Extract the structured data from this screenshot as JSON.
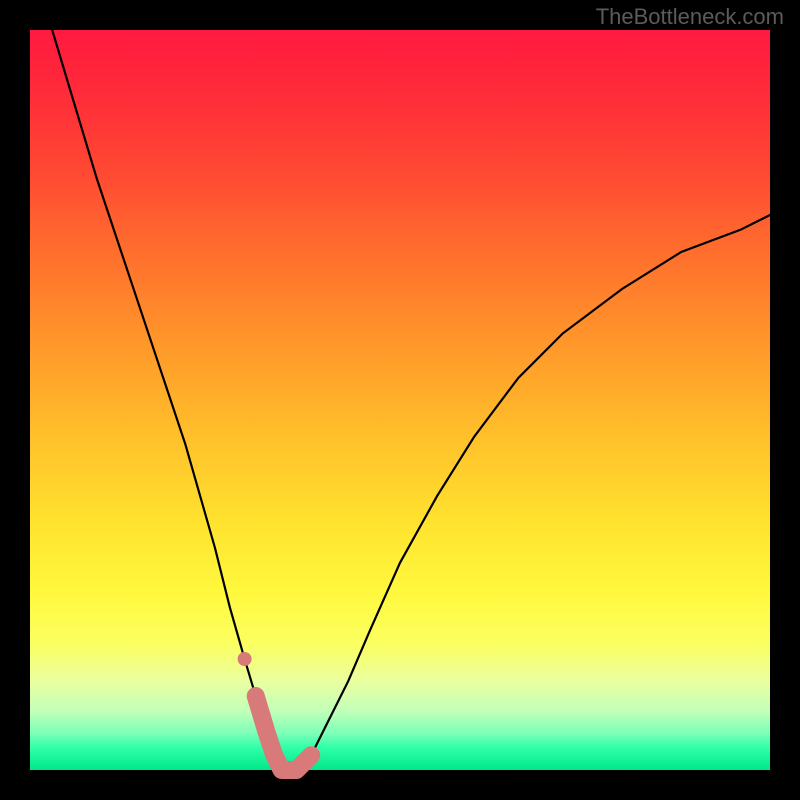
{
  "watermark": "TheBottleneck.com",
  "chart_data": {
    "type": "line",
    "title": "",
    "xlabel": "",
    "ylabel": "",
    "xlim": [
      0,
      100
    ],
    "ylim": [
      0,
      100
    ],
    "grid": false,
    "legend": false,
    "background_gradient": {
      "orientation": "vertical",
      "stops": [
        {
          "pos": 0,
          "color": "#ff1a3f"
        },
        {
          "pos": 18,
          "color": "#ff4533"
        },
        {
          "pos": 42,
          "color": "#ff962a"
        },
        {
          "pos": 66,
          "color": "#ffe12e"
        },
        {
          "pos": 83,
          "color": "#fbff61"
        },
        {
          "pos": 95,
          "color": "#7dffb8"
        },
        {
          "pos": 100,
          "color": "#00e88a"
        }
      ]
    },
    "series": [
      {
        "name": "bottleneck-curve",
        "color": "#000000",
        "x": [
          3,
          6,
          9,
          12,
          15,
          18,
          21,
          23,
          25,
          27,
          29,
          30.5,
          32,
          33,
          34,
          36,
          38,
          40,
          43,
          46,
          50,
          55,
          60,
          66,
          72,
          80,
          88,
          96,
          100
        ],
        "y": [
          100,
          90,
          80,
          71,
          62,
          53,
          44,
          37,
          30,
          22,
          15,
          10,
          5,
          2,
          0,
          0,
          2,
          6,
          12,
          19,
          28,
          37,
          45,
          53,
          59,
          65,
          70,
          73,
          75
        ]
      }
    ],
    "overlay": {
      "name": "highlight-band",
      "color": "#d97a7a",
      "dot": {
        "x": 29,
        "y": 15
      },
      "path": {
        "x": [
          30.5,
          32,
          33,
          34,
          36,
          38
        ],
        "y": [
          10,
          5,
          2,
          0,
          0,
          2
        ]
      }
    }
  }
}
